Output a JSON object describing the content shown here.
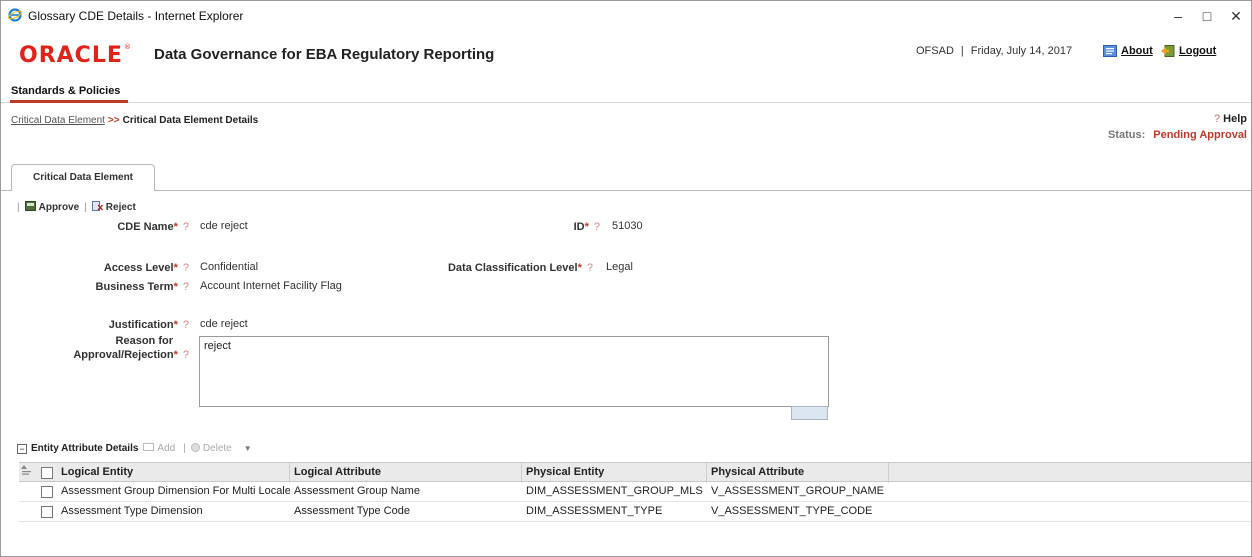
{
  "window": {
    "title": "Glossary CDE Details - Internet Explorer",
    "minimize": "–",
    "maximize": "□",
    "close": "✕"
  },
  "header": {
    "logo": "ORACLE",
    "logo_mark": "®",
    "app_title": "Data Governance for EBA Regulatory Reporting",
    "user": "OFSAD",
    "separator": "|",
    "date": "Friday, July 14, 2017",
    "about_label": "About",
    "logout_label": "Logout"
  },
  "nav": {
    "tab_label": "Standards & Policies"
  },
  "breadcrumb": {
    "parent": "Critical Data Element",
    "separator": ">>",
    "current": "Critical Data Element Details"
  },
  "help": {
    "icon": "?",
    "label": "Help"
  },
  "status": {
    "label": "Status:",
    "value": "Pending Approval"
  },
  "tab": {
    "label": "Critical Data Element"
  },
  "toolbar": {
    "sep": "|",
    "approve_label": "Approve",
    "reject_label": "Reject"
  },
  "form": {
    "cde_name": {
      "label": "CDE Name",
      "value": "cde reject"
    },
    "id": {
      "label": "ID",
      "value": "51030"
    },
    "access_level": {
      "label": "Access Level",
      "value": "Confidential"
    },
    "data_classification": {
      "label": "Data Classification Level",
      "value": "Legal"
    },
    "business_term": {
      "label": "Business Term",
      "value": "Account Internet Facility Flag"
    },
    "justification": {
      "label": "Justification",
      "value": "cde reject"
    },
    "reason": {
      "label_line1": "Reason for",
      "label_line2": "Approval/Rejection",
      "value": "reject"
    },
    "required_mark": "*",
    "help_mark": "?"
  },
  "entity_section": {
    "collapse_icon": "−",
    "title": "Entity Attribute Details",
    "add_label": "Add",
    "sep": "|",
    "delete_label": "Delete",
    "filter_icon": "▼"
  },
  "grid": {
    "columns": [
      "Logical Entity",
      "Logical Attribute",
      "Physical Entity",
      "Physical Attribute"
    ],
    "rows": [
      [
        "Assessment Group Dimension For Multi Locale",
        "Assessment Group Name",
        "DIM_ASSESSMENT_GROUP_MLS",
        "V_ASSESSMENT_GROUP_NAME"
      ],
      [
        "Assessment Type Dimension",
        "Assessment Type Code",
        "DIM_ASSESSMENT_TYPE",
        "V_ASSESSMENT_TYPE_CODE"
      ]
    ]
  },
  "colors": {
    "oracle_red": "#e2231a",
    "accent_red": "#c0392b",
    "header_gray": "#eaeaea"
  }
}
